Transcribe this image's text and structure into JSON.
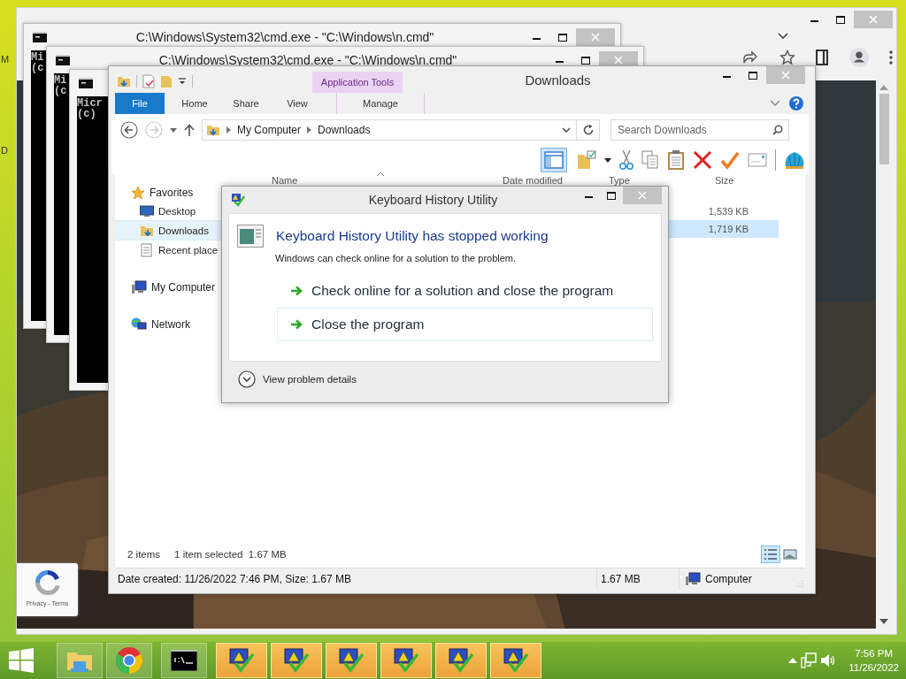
{
  "desktop": {
    "edge_letters": [
      "M",
      "D"
    ]
  },
  "browser": {
    "recaptcha": {
      "links": "Privacy - Terms"
    }
  },
  "cmd_windows": [
    {
      "title": "C:\\Windows\\System32\\cmd.exe - \"C:\\Windows\\n.cmd\"",
      "lines": [
        "Mi",
        "(c"
      ]
    },
    {
      "title": "C:\\Windows\\System32\\cmd.exe - \"C:\\Windows\\n.cmd\"",
      "lines": [
        "Mi",
        "(c"
      ]
    },
    {
      "lines": [
        "Micr",
        "(c)"
      ]
    }
  ],
  "explorer": {
    "title": "Downloads",
    "contextual_group": "Application Tools",
    "ribbon_tabs": [
      {
        "label": "File",
        "kind": "file"
      },
      {
        "label": "Home",
        "kind": "tab"
      },
      {
        "label": "Share",
        "kind": "tab"
      },
      {
        "label": "View",
        "kind": "tab"
      },
      {
        "label": "Manage",
        "kind": "contextual"
      }
    ],
    "breadcrumb": [
      "My Computer",
      "Downloads"
    ],
    "search": {
      "placeholder": "Search Downloads"
    },
    "columns": [
      "Name",
      "Date modified",
      "Type",
      "Size"
    ],
    "navigation": [
      {
        "label": "Favorites",
        "kind": "favorites",
        "selected": false,
        "children": [
          {
            "label": "Desktop",
            "kind": "desktop",
            "selected": false
          },
          {
            "label": "Downloads",
            "kind": "downloads",
            "selected": true
          },
          {
            "label": "Recent place",
            "kind": "recent",
            "selected": false
          }
        ]
      },
      {
        "label": "My Computer",
        "kind": "computer",
        "selected": false
      },
      {
        "label": "Network",
        "kind": "network",
        "selected": false
      }
    ],
    "files": [
      {
        "size": "1,539 KB",
        "selected": false
      },
      {
        "size": "1,719 KB",
        "selected": true
      }
    ],
    "status": {
      "item_count": "2 items",
      "selection": "1 item selected  1.67 MB"
    },
    "view_buttons": [
      {
        "kind": "details",
        "selected": true
      },
      {
        "kind": "large_icons",
        "selected": false
      }
    ],
    "details_bar": {
      "info": "Date created: 11/26/2022 7:46 PM, Size: 1.67 MB",
      "size": "1.67 MB",
      "location": "Computer"
    }
  },
  "dialog": {
    "title": "Keyboard History Utility",
    "heading": "Keyboard History Utility has stopped working",
    "message": "Windows can check online for a solution to the problem.",
    "options": [
      {
        "label": "Check online for a solution and close the program",
        "focused": false
      },
      {
        "label": "Close the program",
        "focused": true
      }
    ],
    "details_toggle": {
      "label": "View problem details",
      "expanded": false
    }
  },
  "taskbar": {
    "buttons": [
      {
        "kind": "explorer",
        "highlighted": false
      },
      {
        "kind": "chrome",
        "highlighted": false
      },
      {
        "kind": "cmd",
        "highlighted": false
      },
      {
        "kind": "app",
        "highlighted": true
      },
      {
        "kind": "app",
        "highlighted": true
      },
      {
        "kind": "app",
        "highlighted": true
      },
      {
        "kind": "app",
        "highlighted": true
      },
      {
        "kind": "app",
        "highlighted": true
      },
      {
        "kind": "app",
        "highlighted": true
      }
    ],
    "time": "7:56 PM",
    "date": "11/26/2022"
  }
}
